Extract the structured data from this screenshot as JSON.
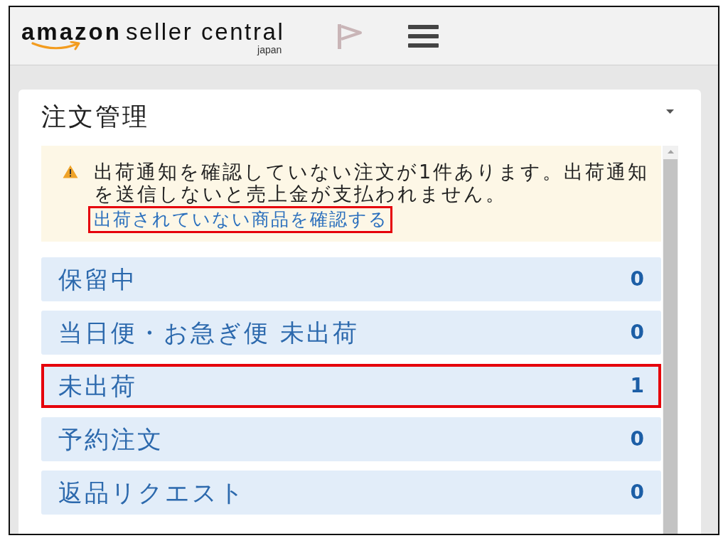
{
  "header": {
    "logo": {
      "brand": "amazon",
      "product": "seller central",
      "region": "japan"
    }
  },
  "widget": {
    "title": "注文管理",
    "alert": {
      "message": "出荷通知を確認していない注文が1件あります。出荷通知を送信しないと売上金が支払われません。",
      "link": {
        "text": "出荷されていない商品を確認する",
        "highlighted": true
      }
    },
    "rows": [
      {
        "label": "保留中",
        "count": "0",
        "highlighted": false
      },
      {
        "label": "当日便・お急ぎ便 未出荷",
        "count": "0",
        "highlighted": false
      },
      {
        "label": "未出荷",
        "count": "1",
        "highlighted": true
      },
      {
        "label": "予約注文",
        "count": "0",
        "highlighted": false
      },
      {
        "label": "返品リクエスト",
        "count": "0",
        "highlighted": false
      }
    ]
  }
}
